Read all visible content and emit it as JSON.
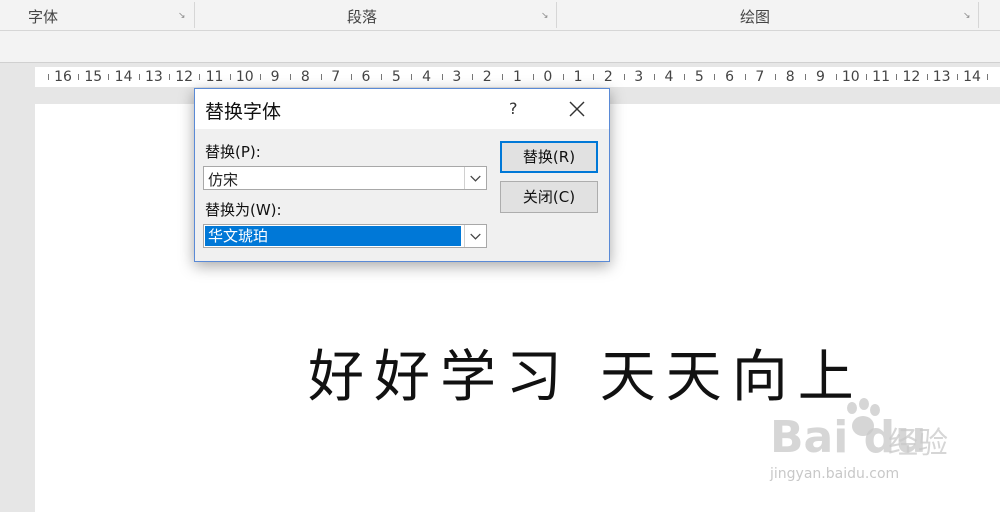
{
  "ribbon": {
    "groups": [
      {
        "label": "字体"
      },
      {
        "label": "段落"
      },
      {
        "label": "绘图"
      }
    ],
    "launcher_glyph": "↘"
  },
  "ruler": {
    "labels": [
      "16",
      "15",
      "14",
      "13",
      "12",
      "11",
      "10",
      "9",
      "8",
      "7",
      "6",
      "5",
      "4",
      "3",
      "2",
      "1",
      "0",
      "1",
      "2",
      "3",
      "4",
      "5",
      "6",
      "7",
      "8",
      "9",
      "10",
      "11",
      "12",
      "13",
      "14"
    ]
  },
  "document": {
    "text": "好好学习 天天向上"
  },
  "dialog": {
    "title": "替换字体",
    "help": "?",
    "replace_label": "替换(P):",
    "replace_value": "仿宋",
    "replace_with_label": "替换为(W):",
    "replace_with_value": "华文琥珀",
    "replace_button": "替换(R)",
    "close_button": "关闭(C)"
  },
  "watermark": {
    "logo": "Bai du",
    "cn": "经验",
    "url": "jingyan.baidu.com"
  },
  "colors": {
    "accent": "#0078d7",
    "dialog_border": "#5a8ad6"
  }
}
